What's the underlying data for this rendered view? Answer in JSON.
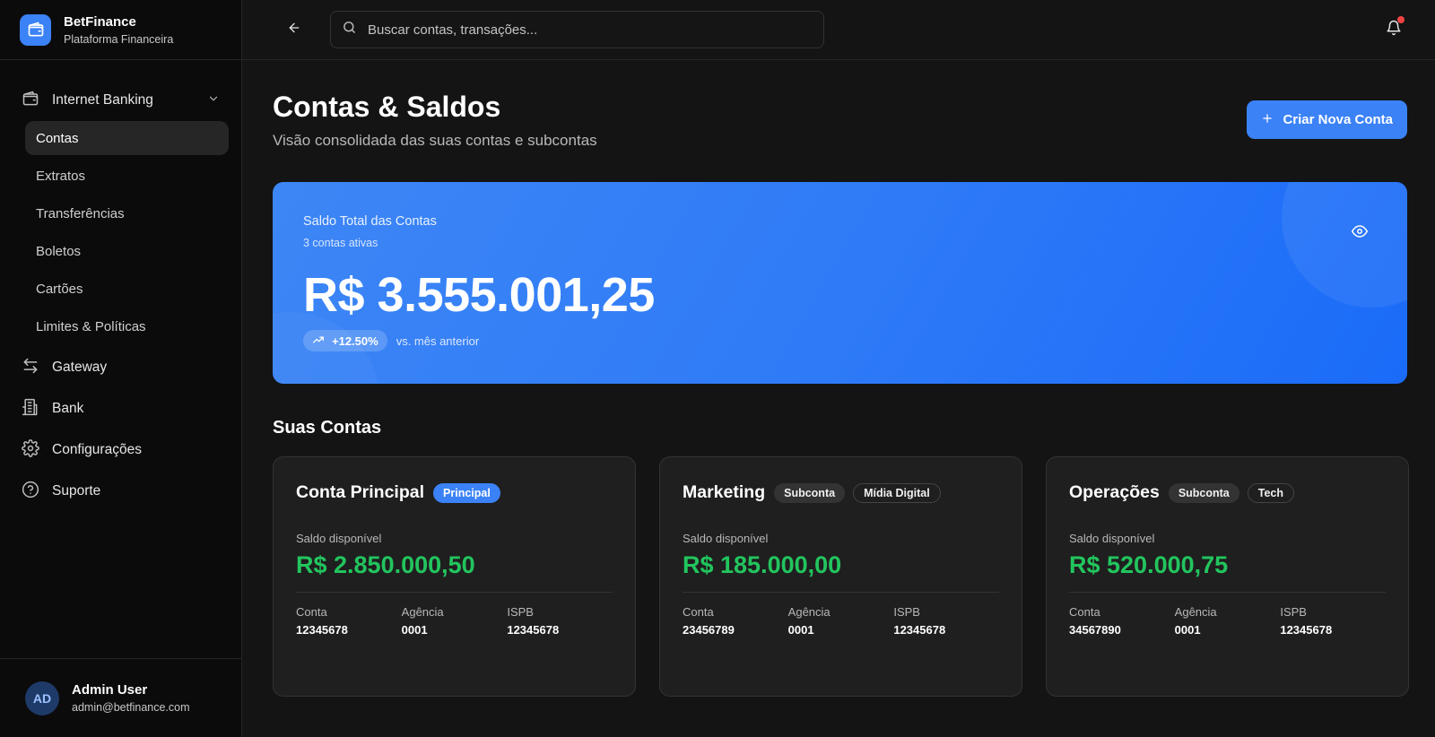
{
  "brand": {
    "name": "BetFinance",
    "subtitle": "Plataforma Financeira"
  },
  "sidebar": {
    "groups": [
      {
        "label": "Internet Banking",
        "icon": "wallet-icon",
        "expanded": true
      },
      {
        "label": "Gateway",
        "icon": "arrows-left-right-icon"
      },
      {
        "label": "Bank",
        "icon": "building-icon"
      },
      {
        "label": "Configurações",
        "icon": "gear-icon"
      },
      {
        "label": "Suporte",
        "icon": "help-circle-icon"
      }
    ],
    "sub_items": [
      "Contas",
      "Extratos",
      "Transferências",
      "Boletos",
      "Cartões",
      "Limites & Políticas"
    ],
    "active_sub_item": "Contas"
  },
  "user": {
    "initials": "AD",
    "name": "Admin User",
    "email": "admin@betfinance.com"
  },
  "topbar": {
    "search_placeholder": "Buscar contas, transações..."
  },
  "page": {
    "title": "Contas & Saldos",
    "subtitle": "Visão consolidada das suas contas e subcontas",
    "cta_label": "Criar Nova Conta"
  },
  "hero": {
    "label": "Saldo Total das Contas",
    "count": "3 contas ativas",
    "total": "R$ 3.555.001,25",
    "trend": "+12.50%",
    "trend_note": "vs. mês anterior"
  },
  "accounts_section": {
    "title": "Suas Contas",
    "balance_label": "Saldo disponível",
    "meta_labels": {
      "account": "Conta",
      "agency": "Agência",
      "ispb": "ISPB"
    }
  },
  "accounts": [
    {
      "name": "Conta Principal",
      "badges": [
        {
          "text": "Principal",
          "style": "primary"
        }
      ],
      "balance": "R$ 2.850.000,50",
      "account": "12345678",
      "agency": "0001",
      "ispb": "12345678"
    },
    {
      "name": "Marketing",
      "badges": [
        {
          "text": "Subconta",
          "style": "secondary"
        },
        {
          "text": "Mídia Digital",
          "style": "outline"
        }
      ],
      "balance": "R$ 185.000,00",
      "account": "23456789",
      "agency": "0001",
      "ispb": "12345678"
    },
    {
      "name": "Operações",
      "badges": [
        {
          "text": "Subconta",
          "style": "secondary"
        },
        {
          "text": "Tech",
          "style": "outline"
        }
      ],
      "balance": "R$ 520.000,75",
      "account": "34567890",
      "agency": "0001",
      "ispb": "12345678"
    }
  ],
  "colors": {
    "accent": "#3b82f6",
    "positive": "#22c55e",
    "notification": "#ef4444"
  }
}
